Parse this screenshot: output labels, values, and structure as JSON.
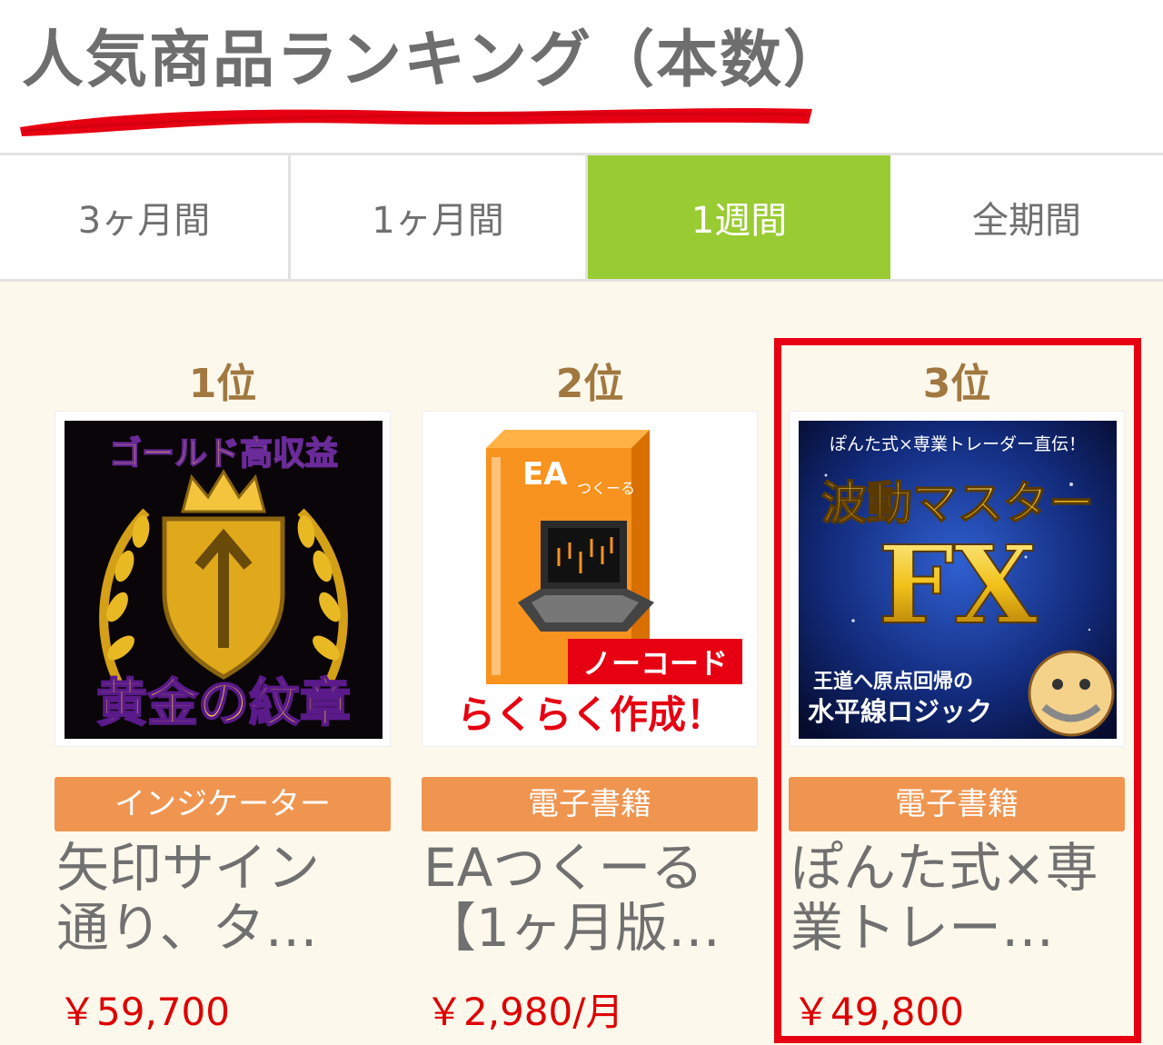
{
  "title": "人気商品ランキング（本数）",
  "colors": {
    "accent": "#99cc33",
    "badge": "#ef9550",
    "price": "#dd0000",
    "rank": "#a07840",
    "highlight": "#e60012",
    "underline": "#e60012"
  },
  "tabs": [
    {
      "label": "3ヶ月間",
      "active": false
    },
    {
      "label": "1ヶ月間",
      "active": false
    },
    {
      "label": "1週間",
      "active": true
    },
    {
      "label": "全期間",
      "active": false
    }
  ],
  "products": [
    {
      "rank": "1位",
      "thumbnail": {
        "text_top": "ゴールド高収益",
        "text_bottom": "黄金の紋章"
      },
      "category": "インジケーター",
      "name_lines": [
        "矢印サイン",
        "通り、タ…"
      ],
      "price": "￥59,700"
    },
    {
      "rank": "2位",
      "thumbnail": {
        "box_label": "EA",
        "box_sub": "つくーる",
        "ribbon": "ノーコード",
        "text_bottom": "らくらく作成！"
      },
      "category": "電子書籍",
      "name_lines": [
        "EAつくーる",
        "【1ヶ月版…"
      ],
      "price": "￥2,980/月"
    },
    {
      "rank": "3位",
      "thumbnail": {
        "text_top": "ぽんた式×専業トレーダー直伝！",
        "text_main": "波動マスター",
        "text_fx": "FX",
        "text_sub1": "王道へ原点回帰の",
        "text_sub2": "水平線ロジック"
      },
      "category": "電子書籍",
      "name_lines": [
        "ぽんた式×専",
        "業トレー…"
      ],
      "price": "￥49,800"
    }
  ]
}
